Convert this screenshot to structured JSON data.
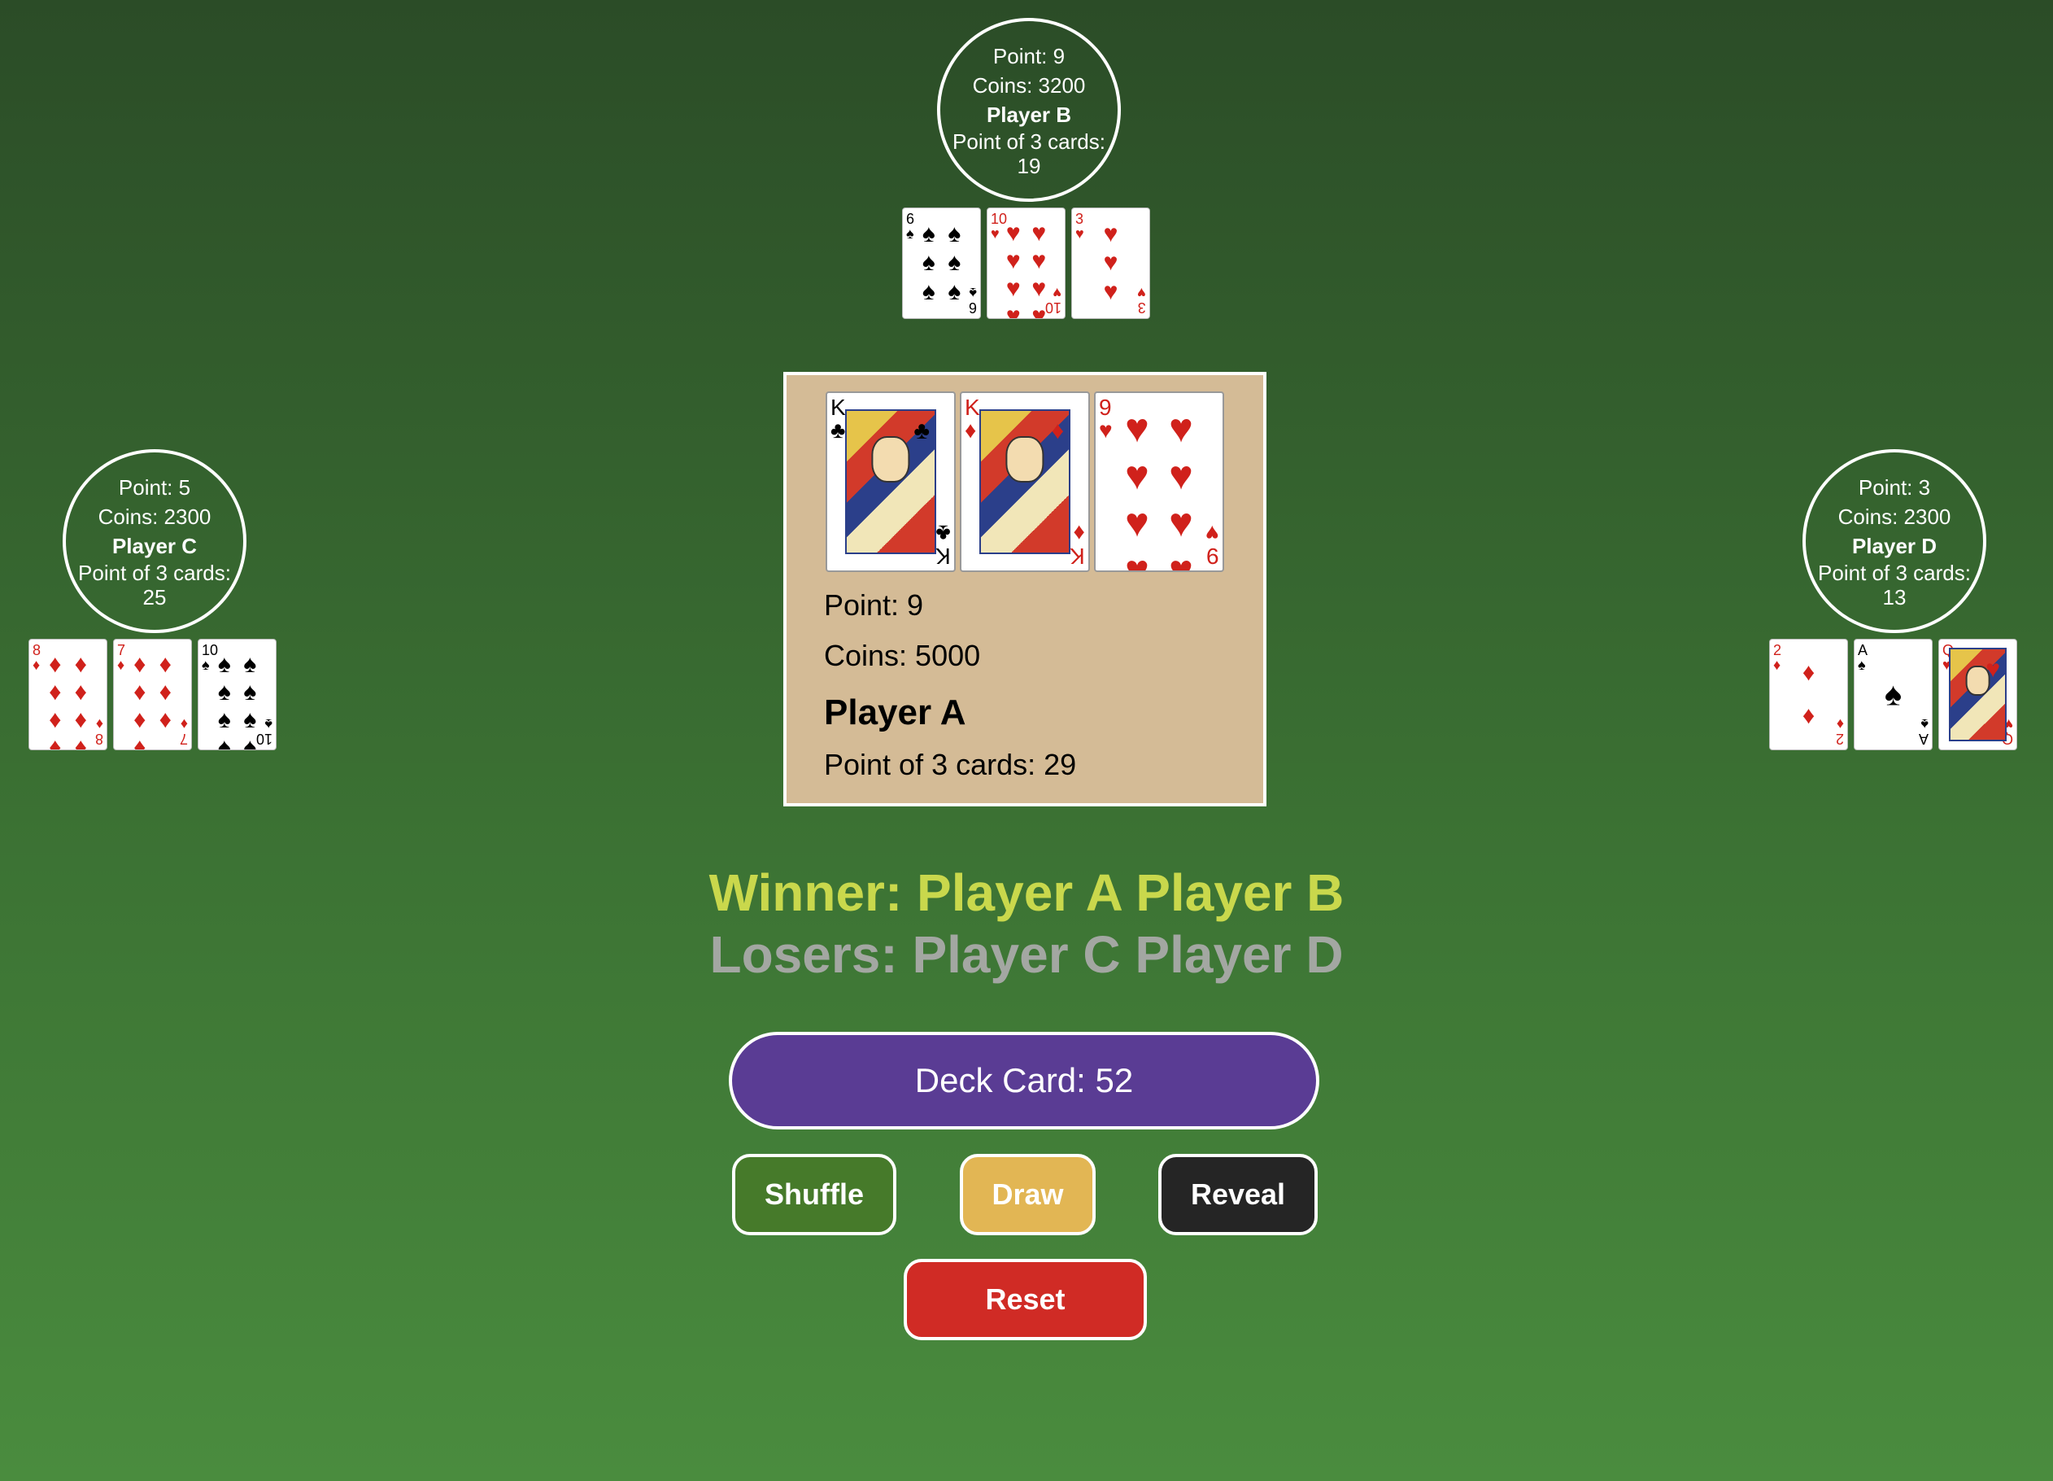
{
  "players": {
    "b": {
      "point": "Point: 9",
      "coins": "Coins: 3200",
      "name": "Player B",
      "three_label": "Point of 3 cards:",
      "three_value": "19",
      "cards": [
        {
          "rank": "6",
          "suit": "♠",
          "color": "black"
        },
        {
          "rank": "10",
          "suit": "♥",
          "color": "red"
        },
        {
          "rank": "3",
          "suit": "♥",
          "color": "red"
        }
      ]
    },
    "c": {
      "point": "Point: 5",
      "coins": "Coins: 2300",
      "name": "Player C",
      "three_label": "Point of 3 cards:",
      "three_value": "25",
      "cards": [
        {
          "rank": "8",
          "suit": "♦",
          "color": "red"
        },
        {
          "rank": "7",
          "suit": "♦",
          "color": "red"
        },
        {
          "rank": "10",
          "suit": "♠",
          "color": "black"
        }
      ]
    },
    "d": {
      "point": "Point: 3",
      "coins": "Coins: 2300",
      "name": "Player D",
      "three_label": "Point of 3 cards:",
      "three_value": "13",
      "cards": [
        {
          "rank": "2",
          "suit": "♦",
          "color": "red"
        },
        {
          "rank": "A",
          "suit": "♠",
          "color": "black"
        },
        {
          "rank": "Q",
          "suit": "♥",
          "color": "red"
        }
      ]
    },
    "a": {
      "point": "Point: 9",
      "coins": "Coins: 5000",
      "name": "Player A",
      "three": "Point of 3 cards: 29",
      "cards": [
        {
          "rank": "K",
          "suit": "♣",
          "color": "black"
        },
        {
          "rank": "K",
          "suit": "♦",
          "color": "red"
        },
        {
          "rank": "9",
          "suit": "♥",
          "color": "red"
        }
      ]
    }
  },
  "result": {
    "winner": "Winner: Player A Player B",
    "losers": "Losers: Player C Player D"
  },
  "controls": {
    "deck": "Deck Card: 52",
    "shuffle": "Shuffle",
    "draw": "Draw",
    "reveal": "Reveal",
    "reset": "Reset"
  },
  "colors": {
    "winner": "#c9d84c",
    "losers": "#a3a7a2",
    "deck_button": "#5a3c94",
    "shuffle_button": "#467a2a",
    "draw_button": "#e2b654",
    "reveal_button": "#252525",
    "reset_button": "#d02b25",
    "player_a_panel": "#d4bb96"
  }
}
